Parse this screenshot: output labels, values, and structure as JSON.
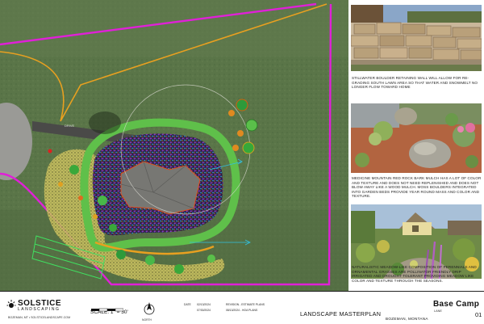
{
  "photos": [
    {
      "caption": "Stillwater boulder retaining wall will allow for re-grading south lawn area so that water and snowmelt no longer flow toward home"
    },
    {
      "caption": "Medicine Mountain red rock bark mulch has a lot of color and texture and does not need replenished and does not blow away like a wood mulch.  Moss boulders integrated into garden beds provide year round mass and color and texture."
    },
    {
      "caption": "Naturalistic meadow-like composition of perennials and ornamental grasses are pollinator friendly drip irrigated and drought tolerant providing meadow like color and texture through the seasons."
    }
  ],
  "plan": {
    "label_driveway": "DRIVE",
    "label_path": "PATH"
  },
  "title_block": {
    "logo_name": "SOLSTICE",
    "logo_sub": "LANDSCAPING",
    "logo_contact": "BOZEMAN, MT • SOLSTICELANDSCAPE.COM",
    "scale": "SCALE: 1\" = 30'",
    "north_label": "NORTH",
    "date_label": "DATE",
    "dates": [
      "02/13/2024",
      "07/30/2024"
    ],
    "revisions": [
      "REVISION - ESTIMATE PLANS",
      "08/13/2024 - HOA PLANS"
    ],
    "project": "LANDSCAPE MASTERPLAN",
    "location": "BOZEMAN, MONTANA",
    "client": "Base Camp",
    "lane": "LANE",
    "sheet": "01"
  }
}
